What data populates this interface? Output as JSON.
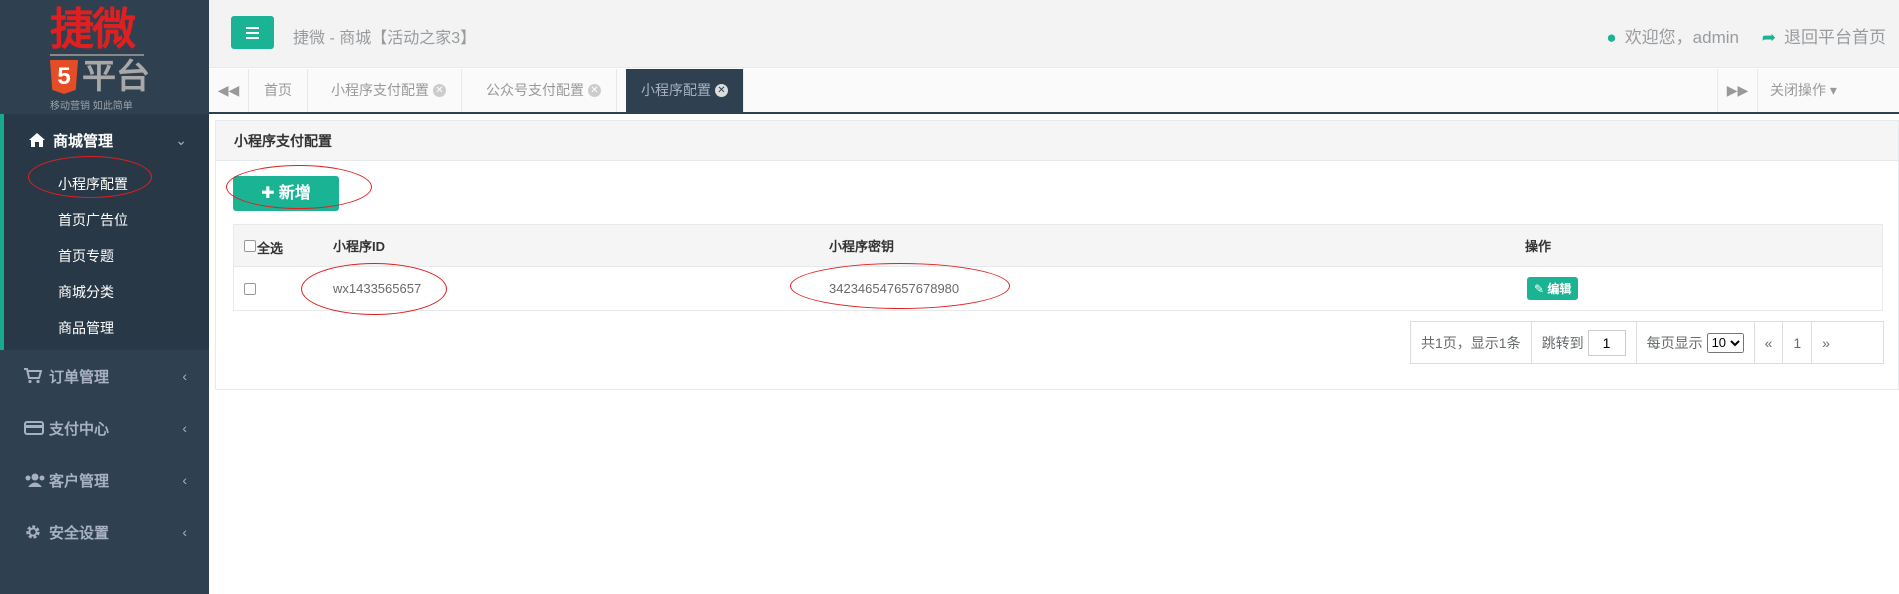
{
  "logo": {
    "brand": "捷微",
    "sub": "平台",
    "shield": "5",
    "slogan": "移动营销 如此简单"
  },
  "sidebar": {
    "groups": [
      {
        "label": "商城管理",
        "icon": "home-icon",
        "expanded": true,
        "items": [
          {
            "label": "小程序配置",
            "current": true
          },
          {
            "label": "首页广告位"
          },
          {
            "label": "首页专题"
          },
          {
            "label": "商城分类"
          },
          {
            "label": "商品管理"
          }
        ]
      },
      {
        "label": "订单管理",
        "icon": "cart-icon"
      },
      {
        "label": "支付中心",
        "icon": "credit-card-icon"
      },
      {
        "label": "客户管理",
        "icon": "users-icon"
      },
      {
        "label": "安全设置",
        "icon": "gear-icon"
      }
    ]
  },
  "header": {
    "title": "捷微 - 商城【活动之家3】",
    "welcome": "欢迎您，admin",
    "back_label": "退回平台首页"
  },
  "tabs": {
    "items": [
      {
        "label": "首页",
        "closable": false
      },
      {
        "label": "小程序支付配置",
        "closable": true
      },
      {
        "label": "公众号支付配置",
        "closable": true
      },
      {
        "label": "小程序配置",
        "closable": true,
        "active": true
      }
    ],
    "close_ops": "关闭操作"
  },
  "panel": {
    "title": "小程序支付配置",
    "add_label": "新增",
    "columns": {
      "select_all": "全选",
      "app_id": "小程序ID",
      "app_secret": "小程序密钥",
      "ops": "操作"
    },
    "rows": [
      {
        "app_id": "wx1433565657",
        "app_secret": "342346547657678980",
        "edit_label": "编辑"
      }
    ],
    "pager": {
      "summary": "共1页，显示1条",
      "jump_label": "跳转到",
      "jump_value": "1",
      "per_page_label": "每页显示",
      "per_page_value": "10",
      "prev": "«",
      "page": "1",
      "next": "»"
    }
  },
  "colors": {
    "sidebar": "#2f4050",
    "accent": "#1ab394",
    "annotation": "#e02020"
  }
}
